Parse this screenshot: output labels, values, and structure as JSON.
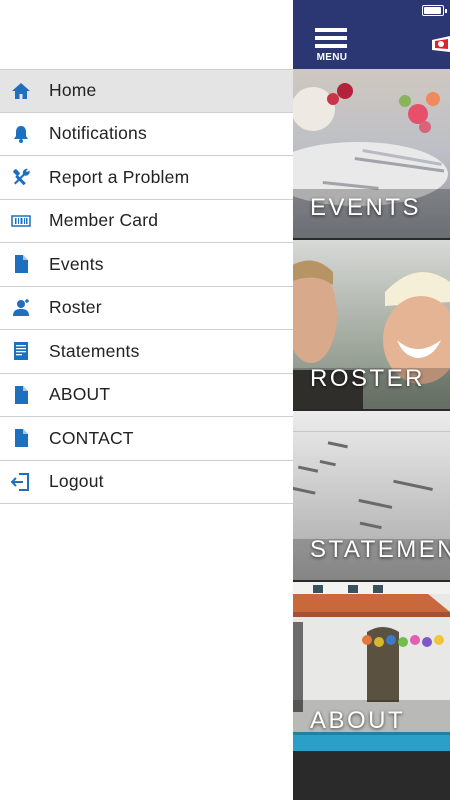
{
  "drawer": {
    "items": [
      {
        "label": "Home",
        "icon": "home-icon",
        "active": true
      },
      {
        "label": "Notifications",
        "icon": "bell-icon"
      },
      {
        "label": "Report a Problem",
        "icon": "tools-icon"
      },
      {
        "label": "Member Card",
        "icon": "barcode-icon"
      },
      {
        "label": "Events",
        "icon": "document-icon"
      },
      {
        "label": "Roster",
        "icon": "person-icon"
      },
      {
        "label": "Statements",
        "icon": "statement-icon"
      },
      {
        "label": "ABOUT",
        "icon": "document-icon"
      },
      {
        "label": "CONTACT",
        "icon": "document-icon"
      },
      {
        "label": "Logout",
        "icon": "logout-icon"
      }
    ]
  },
  "appbar": {
    "menu_label": "MENU",
    "battery_level": 0.85
  },
  "tiles": [
    {
      "caption": "EVENTS"
    },
    {
      "caption": "ROSTER"
    },
    {
      "caption": "STATEMENTS"
    },
    {
      "caption": "ABOUT"
    }
  ],
  "colors": {
    "accent": "#1f6fbf",
    "appbar": "#2a3773",
    "active_row": "#e4e4e4"
  }
}
